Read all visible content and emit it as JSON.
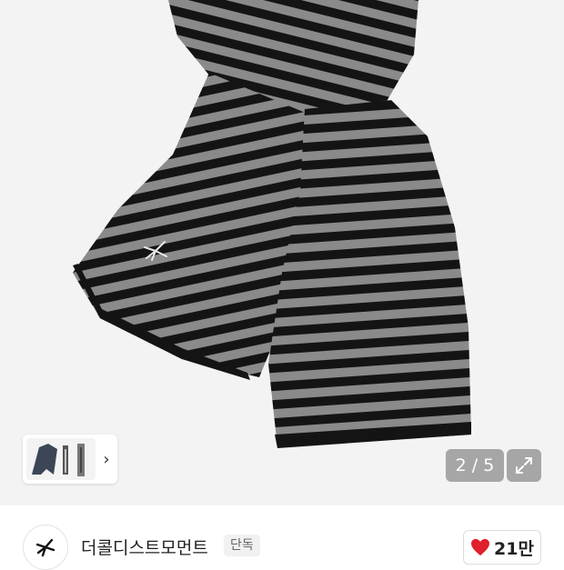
{
  "gallery": {
    "current": 2,
    "total": 5,
    "counter_text": "2 / 5",
    "next_thumb_label": "›",
    "product": "black-grey-striped-knit-scarf"
  },
  "colors": {
    "stripe_dark": "#141414",
    "stripe_light": "#8a8a8a",
    "like_heart": "#e0202c",
    "hero_bg": "#f3f3f3"
  },
  "brand": {
    "name": "더콜디스트모먼트",
    "badge": "단독"
  },
  "like": {
    "count": "21만"
  },
  "icons": {
    "expand": "expand-icon",
    "next": "chevron-right-icon",
    "heart": "heart-icon",
    "logo": "star-logo-icon"
  }
}
